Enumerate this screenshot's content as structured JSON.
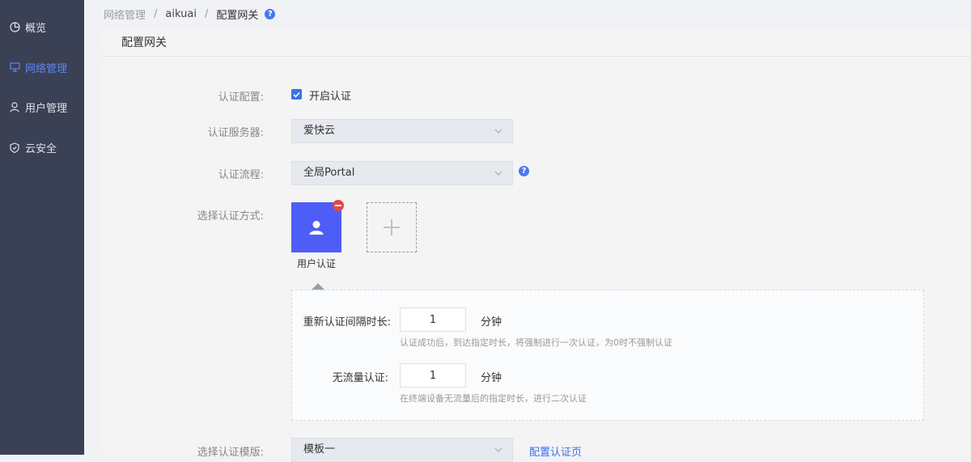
{
  "sidebar": {
    "items": [
      {
        "label": "概览",
        "icon": "pie-chart-icon"
      },
      {
        "label": "网络管理",
        "icon": "monitor-icon",
        "active": true
      },
      {
        "label": "用户管理",
        "icon": "user-icon"
      },
      {
        "label": "云安全",
        "icon": "shield-icon"
      }
    ]
  },
  "breadcrumb": {
    "root": "网络管理",
    "middle": "aikuai",
    "current": "配置网关",
    "help": "?"
  },
  "panel": {
    "title": "配置网关"
  },
  "form": {
    "auth_config": {
      "label": "认证配置:",
      "checkbox_label": "开启认证",
      "checked": true
    },
    "auth_server": {
      "label": "认证服务器:",
      "value": "爱快云"
    },
    "auth_flow": {
      "label": "认证流程:",
      "value": "全局Portal",
      "help": "?"
    },
    "auth_method": {
      "label": "选择认证方式:",
      "card_label": "用户认证"
    },
    "reauth": {
      "label": "重新认证间隔时长:",
      "value": "1",
      "unit": "分钟",
      "hint": "认证成功后，到达指定时长，将强制进行一次认证，为0时不强制认证"
    },
    "no_traffic": {
      "label": "无流量认证:",
      "value": "1",
      "unit": "分钟",
      "hint": "在终端设备无流量后的指定时长，进行二次认证"
    },
    "template": {
      "label": "选择认证模版:",
      "value": "模板一",
      "link": "配置认证页"
    }
  },
  "colors": {
    "sidebar_bg": "#3b4154",
    "accent": "#3d6fe8",
    "card_bg": "#4f5df7",
    "remove_badge": "#e04848"
  }
}
